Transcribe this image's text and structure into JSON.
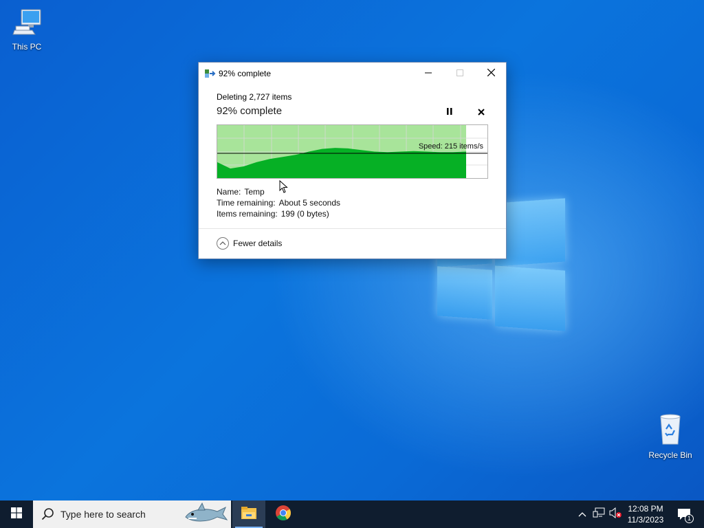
{
  "desktop": {
    "icons": [
      {
        "label": "This PC",
        "icon": "computer-icon"
      },
      {
        "label": "Recycle Bin",
        "icon": "recycle-bin-icon"
      }
    ]
  },
  "dialog": {
    "window_title": "92% complete",
    "subtitle": "Deleting 2,727 items",
    "heading": "92% complete",
    "progress_percent": 92,
    "speed": "Speed: 215 items/s",
    "details": {
      "name_label": "Name:",
      "name_value": "Temp",
      "time_label": "Time remaining:",
      "time_value": "About 5 seconds",
      "items_label": "Items remaining:",
      "items_value": "199 (0 bytes)"
    },
    "fewer_details": "Fewer details",
    "controls": {
      "minimize_icon": "minimize-icon",
      "maximize_icon": "maximize-icon",
      "close_icon": "close-icon",
      "pause_icon": "pause-icon",
      "cancel_icon": "cancel-icon"
    }
  },
  "taskbar": {
    "search_placeholder": "Type here to search",
    "apps": [
      "file-explorer-icon",
      "chrome-icon"
    ],
    "clock_time": "12:08 PM",
    "clock_date": "11/3/2023",
    "notification_count": "1"
  },
  "colors": {
    "progress_fill": "#06b025",
    "progress_bg": "#a8e49a",
    "taskbar": "#0f1d2f"
  }
}
